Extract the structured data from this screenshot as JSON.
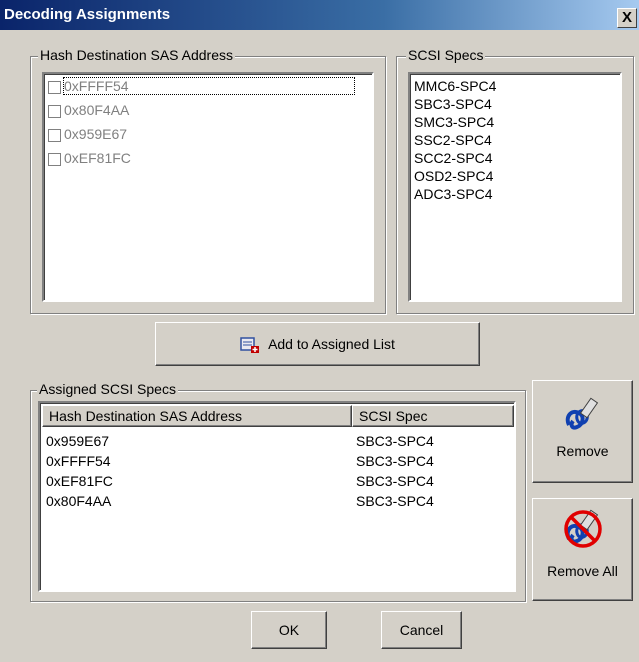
{
  "window": {
    "title": "Decoding Assignments",
    "close_label": "X"
  },
  "hash_group": {
    "label": "Hash Destination SAS Address",
    "items": [
      {
        "label": "0xFFFF54"
      },
      {
        "label": "0x80F4AA"
      },
      {
        "label": "0x959E67"
      },
      {
        "label": "0xEF81FC"
      }
    ]
  },
  "specs_group": {
    "label": "SCSI Specs",
    "items": [
      {
        "label": "MMC6-SPC4"
      },
      {
        "label": "SBC3-SPC4"
      },
      {
        "label": "SMC3-SPC4"
      },
      {
        "label": "SSC2-SPC4"
      },
      {
        "label": "SCC2-SPC4"
      },
      {
        "label": "OSD2-SPC4"
      },
      {
        "label": "ADC3-SPC4"
      }
    ]
  },
  "add_button": {
    "label": "Add  to Assigned List",
    "icon": "add-to-list-icon"
  },
  "assigned_group": {
    "label": "Assigned SCSI Specs",
    "columns": [
      "Hash Destination SAS Address",
      "SCSI Spec"
    ],
    "rows": [
      {
        "address": "0x959E67",
        "spec": "SBC3-SPC4"
      },
      {
        "address": "0xFFFF54",
        "spec": "SBC3-SPC4"
      },
      {
        "address": "0xEF81FC",
        "spec": "SBC3-SPC4"
      },
      {
        "address": "0x80F4AA",
        "spec": "SBC3-SPC4"
      }
    ]
  },
  "side_buttons": {
    "remove_label": "Remove",
    "remove_all_label": "Remove All"
  },
  "footer": {
    "ok_label": "OK",
    "cancel_label": "Cancel"
  }
}
